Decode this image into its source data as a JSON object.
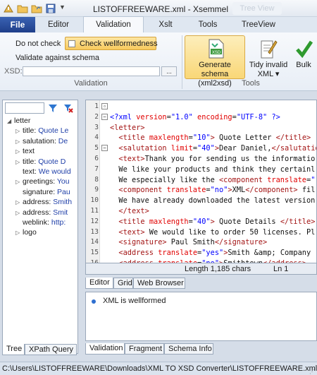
{
  "window": {
    "title": "LISTOFFREEWARE.xml - Xsemmel",
    "contextual_tab_ghost": "Tree View"
  },
  "ribbon": {
    "tabs": [
      {
        "label": "File"
      },
      {
        "label": "Editor"
      },
      {
        "label": "Validation",
        "active": true
      },
      {
        "label": "Xslt"
      },
      {
        "label": "Tools"
      },
      {
        "label": "TreeView"
      }
    ],
    "validation_group": {
      "dont_check": "Do not check",
      "check_wellformedness": "Check wellformedness",
      "validate_against_schema": "Validate against schema",
      "xsd_label": "XSD:",
      "xsd_value": "",
      "browse_label": "...",
      "group_label": "Validation"
    },
    "tools_group": {
      "generate_schema": "Generate schema (xml2xsd)",
      "tidy_invalid": "Tidy invalid XML",
      "bulk": "Bulk",
      "group_label": "Tools"
    }
  },
  "tree": {
    "search_value": "",
    "nodes": [
      {
        "label": "letter",
        "value": "",
        "arrow": "◢"
      },
      {
        "label": "title: ",
        "value": "Quote Le",
        "arrow": "▷"
      },
      {
        "label": "salutation: ",
        "value": "De",
        "arrow": "▷"
      },
      {
        "label": "text",
        "value": "",
        "arrow": "▷"
      },
      {
        "label": "title: ",
        "value": "Quote D",
        "arrow": "▷"
      },
      {
        "label": "text: ",
        "value": "We would",
        "arrow": ""
      },
      {
        "label": "greetings: ",
        "value": "You",
        "arrow": "▷"
      },
      {
        "label": "signature: ",
        "value": "Pau",
        "arrow": ""
      },
      {
        "label": "address: ",
        "value": "Smith",
        "arrow": "▷"
      },
      {
        "label": "address: ",
        "value": "Smit",
        "arrow": "▷"
      },
      {
        "label": "weblink: ",
        "value": "http:",
        "arrow": ""
      },
      {
        "label": "logo",
        "value": "",
        "arrow": "▷"
      }
    ],
    "tabs": [
      {
        "label": "Tree"
      },
      {
        "label": "XPath Query"
      }
    ]
  },
  "editor": {
    "line_numbers": [
      "1",
      "2",
      "3",
      "4",
      "5",
      "6",
      "7",
      "8",
      "9",
      "10",
      "11",
      "12",
      "13",
      "14",
      "15",
      "16"
    ],
    "status_length": "Length 1,185 chars",
    "status_line": "Ln 1",
    "tabs": [
      {
        "label": "Editor"
      },
      {
        "label": "Grid"
      },
      {
        "label": "Web Browser"
      }
    ]
  },
  "validation_result": {
    "message": "XML is wellformed",
    "tabs": [
      {
        "label": "Validation"
      },
      {
        "label": "Fragment"
      },
      {
        "label": "Schema Info"
      }
    ]
  },
  "statusbar": {
    "path": "C:\\Users\\LISTOFFREEWARE\\Downloads\\XML TO XSD Converter\\LISTOFFREEWARE.xml"
  },
  "colors": {
    "file_tab": "#2a4f9e",
    "highlight": "#f8c95c",
    "xml_tag": "#a31515",
    "xml_attr": "#e10000",
    "xml_value": "#0000ff"
  }
}
